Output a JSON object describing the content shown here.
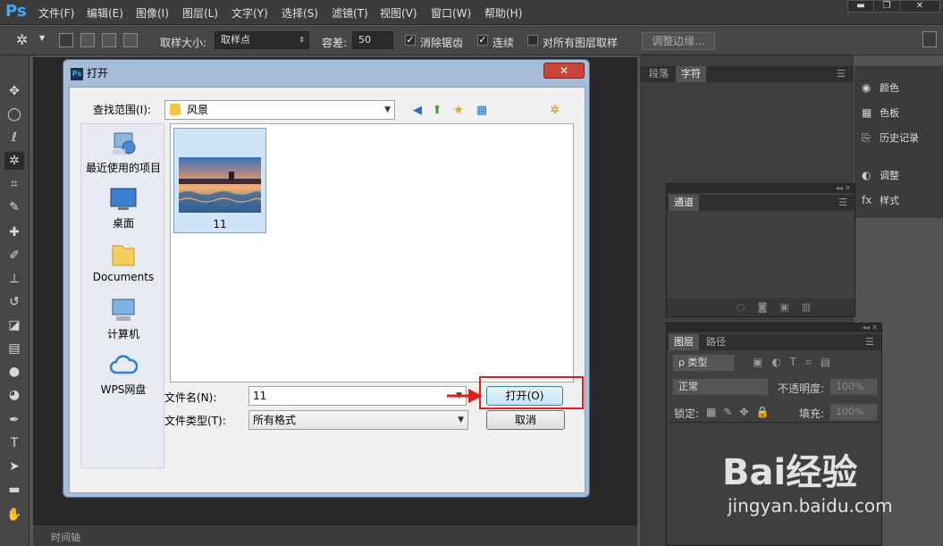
{
  "app": {
    "logo": "Ps"
  },
  "menu": [
    "文件(F)",
    "编辑(E)",
    "图像(I)",
    "图层(L)",
    "文字(Y)",
    "选择(S)",
    "滤镜(T)",
    "视图(V)",
    "窗口(W)",
    "帮助(H)"
  ],
  "window_controls": {
    "minimize": "▬",
    "restore": "❐",
    "close": "✕"
  },
  "options": {
    "sample_size_label": "取样大小:",
    "sample_size_value": "取样点",
    "tolerance_label": "容差:",
    "tolerance_value": "50",
    "antialias_label": "消除锯齿",
    "antialias_checked": true,
    "contiguous_label": "连续",
    "contiguous_checked": true,
    "all_layers_label": "对所有图层取样",
    "all_layers_checked": false,
    "refine_edge": "调整边缘..."
  },
  "panels": {
    "top_tabs": [
      "段落",
      "字符"
    ],
    "side_items": [
      {
        "icon": "palette-icon",
        "label": "颜色"
      },
      {
        "icon": "swatches-icon",
        "label": "色板"
      },
      {
        "icon": "history-icon",
        "label": "历史记录"
      },
      {
        "icon": "adjustments-icon",
        "label": "调整"
      },
      {
        "icon": "fx-icon",
        "label": "样式"
      }
    ],
    "channels_tab": "通道",
    "layers_tabs": [
      "图层",
      "路径"
    ],
    "layers_filter": "ρ 类型",
    "blend_mode": "正常",
    "opacity_label": "不透明度:",
    "opacity_value": "100%",
    "lock_label": "锁定:",
    "fill_label": "填充:",
    "fill_value": "100%"
  },
  "timeline": {
    "label": "时间轴"
  },
  "dialog": {
    "title": "打开",
    "close": "✕",
    "look_in_label": "查找范围(I):",
    "look_in_value": "风景",
    "places": [
      "最近使用的项目",
      "桌面",
      "Documents",
      "计算机",
      "WPS网盘"
    ],
    "file": {
      "name": "11"
    },
    "filename_label": "文件名(N):",
    "filename_value": "11",
    "filetype_label": "文件类型(T):",
    "filetype_value": "所有格式",
    "open_button": "打开(O)",
    "cancel_button": "取消"
  },
  "watermark": {
    "brand": "Bai经验",
    "url": "jingyan.baidu.com"
  },
  "colors": {
    "accent": "#e02020",
    "ps_blue": "#4aa8f0"
  }
}
